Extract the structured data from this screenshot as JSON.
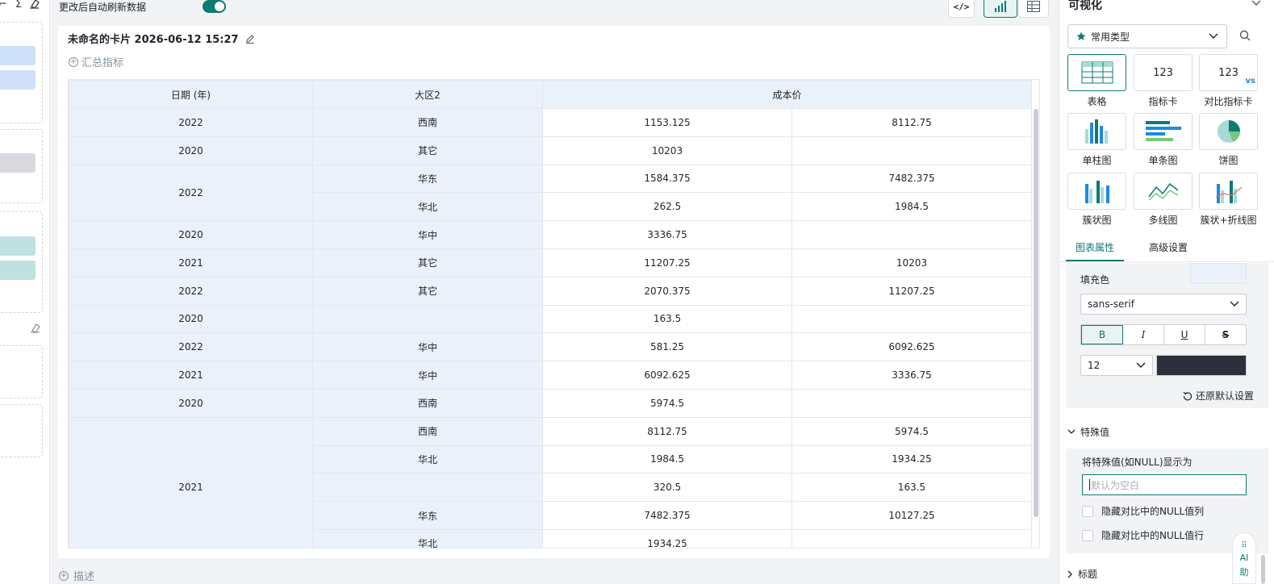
{
  "toolbar": {
    "auto_refresh_label": "更改后自动刷新数据",
    "auto_refresh_on": true
  },
  "card": {
    "title": "未命名的卡片 2026-06-12 15:27",
    "summary_label": "汇总指标",
    "description_label": "描述"
  },
  "table": {
    "headers": [
      "日期 (年)",
      "大区2",
      "成本价"
    ],
    "rows": [
      {
        "year": "2022",
        "region": "西南",
        "v1": "1153.125",
        "v2": "8112.75"
      },
      {
        "year": "2020",
        "region": "其它",
        "v1": "10203",
        "v2": ""
      },
      {
        "year": "2022",
        "region": "华东",
        "v1": "1584.375",
        "v2": "7482.375"
      },
      {
        "year": "",
        "region": "华北",
        "v1": "262.5",
        "v2": "1984.5"
      },
      {
        "year": "2020",
        "region": "华中",
        "v1": "3336.75",
        "v2": ""
      },
      {
        "year": "2021",
        "region": "其它",
        "v1": "11207.25",
        "v2": "10203"
      },
      {
        "year": "2022",
        "region": "其它",
        "v1": "2070.375",
        "v2": "11207.25"
      },
      {
        "year": "2020",
        "region": "",
        "v1": "163.5",
        "v2": ""
      },
      {
        "year": "2022",
        "region": "华中",
        "v1": "581.25",
        "v2": "6092.625"
      },
      {
        "year": "2021",
        "region": "华中",
        "v1": "6092.625",
        "v2": "3336.75"
      },
      {
        "year": "2020",
        "region": "西南",
        "v1": "5974.5",
        "v2": ""
      },
      {
        "year": "2021",
        "region": "西南",
        "v1": "8112.75",
        "v2": "5974.5"
      },
      {
        "year": "",
        "region": "华北",
        "v1": "1984.5",
        "v2": "1934.25"
      },
      {
        "year": "",
        "region": "",
        "v1": "320.5",
        "v2": "163.5"
      },
      {
        "year": "",
        "region": "华东",
        "v1": "7482.375",
        "v2": "10127.25"
      },
      {
        "year": "",
        "region": "华北",
        "v1": "1934.25",
        "v2": ""
      }
    ]
  },
  "panel": {
    "title": "可视化",
    "type_select": "常用类型",
    "chart_types": [
      {
        "label": "表格",
        "icon": "table-chart-icon"
      },
      {
        "label": "指标卡",
        "icon": "metric-card-icon",
        "glyph": "123"
      },
      {
        "label": "对比指标卡",
        "icon": "compare-metric-card-icon",
        "glyph": "123",
        "glyph2": "vs"
      },
      {
        "label": "单柱图",
        "icon": "column-chart-icon"
      },
      {
        "label": "单条图",
        "icon": "bar-chart-icon"
      },
      {
        "label": "饼图",
        "icon": "pie-chart-icon"
      },
      {
        "label": "簇状图",
        "icon": "clustered-chart-icon"
      },
      {
        "label": "多线图",
        "icon": "multi-line-chart-icon"
      },
      {
        "label": "簇状+折线图",
        "icon": "combo-chart-icon"
      }
    ],
    "tabs": [
      "图表属性",
      "高级设置"
    ],
    "fill_label": "填充色",
    "font_family": "sans-serif",
    "style_buttons": [
      "B",
      "I",
      "U",
      "S"
    ],
    "font_size": "12",
    "reset_label": "还原默认设置",
    "special_section": "特殊值",
    "special_label": "将特殊值(如NULL)显示为",
    "special_placeholder": "默认为空白",
    "hide_null_col": "隐藏对比中的NULL值列",
    "hide_null_row": "隐藏对比中的NULL值行",
    "title_section": "标题",
    "ai_label": "AI助"
  },
  "colors": {
    "accent": "#0e7a73",
    "dim_cell": "#eaf1fa",
    "text_color_swatch": "#2b303b"
  }
}
